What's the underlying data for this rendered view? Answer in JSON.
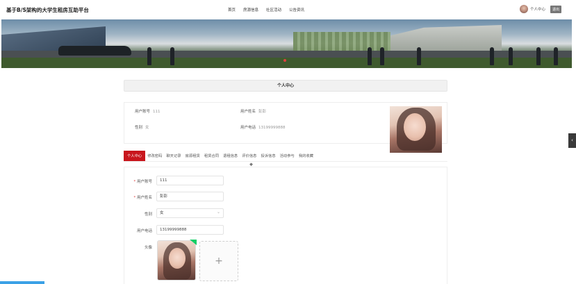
{
  "header": {
    "site_title": "基于B/S架构的大学生租房互助平台",
    "nav": [
      "首页",
      "房源信息",
      "社区活动",
      "公告资讯"
    ],
    "user_label": "个人中心",
    "logout_label": "退出"
  },
  "section_title": "个人中心",
  "profile": {
    "account_label": "用户账号",
    "account_value": "111",
    "name_label": "用户姓名",
    "name_value": "彭彭",
    "gender_label": "性别",
    "gender_value": "女",
    "phone_label": "用户电话",
    "phone_value": "13199999888"
  },
  "tabs": [
    "个人中心",
    "修改密码",
    "聊天记录",
    "房源租赁",
    "租赁合同",
    "退租信息",
    "评价信息",
    "投诉信息",
    "活动参与",
    "我的收藏"
  ],
  "form": {
    "account_label": "用户账号",
    "account_value": "111",
    "name_label": "用户姓名",
    "name_value": "彭彭",
    "gender_label": "性别",
    "gender_value": "女",
    "phone_label": "用户电话",
    "phone_value": "13199999888",
    "avatar_label": "头像",
    "add_symbol": "+"
  },
  "icons": {
    "side_toggle": "chevron-left-icon",
    "carousel_prev": "chevron-left-icon"
  },
  "colors": {
    "accent": "#c8161d",
    "upload_success": "#13ce66",
    "carousel_indicator": "#e04040"
  }
}
